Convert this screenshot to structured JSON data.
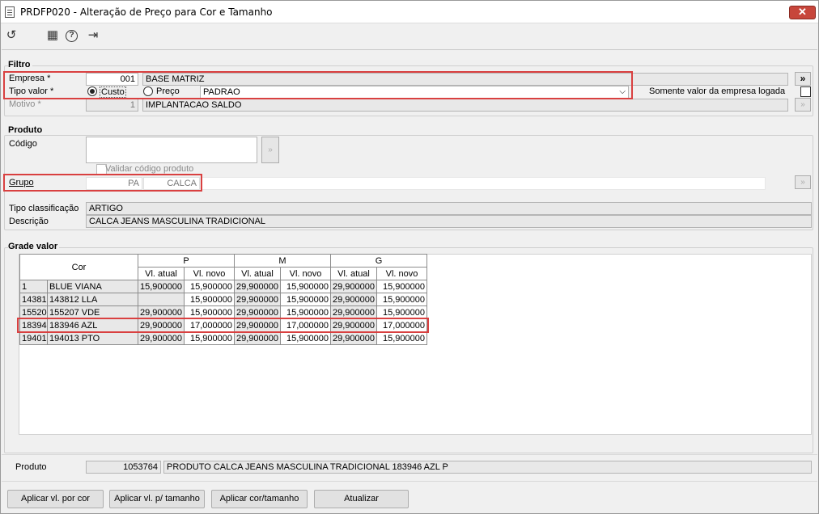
{
  "window": {
    "title": "PRDFP020 - Alteração de Preço para Cor e Tamanho",
    "close": "✕"
  },
  "toolbar": {
    "refresh": "↺",
    "calendar": "▦",
    "help": "?",
    "exit": "⇥"
  },
  "filtro": {
    "label": "Filtro",
    "empresa_label": "Empresa *",
    "empresa_code": "001",
    "empresa_name": "BASE MATRIZ",
    "tipo_valor_label": "Tipo valor *",
    "custo_label": "Custo",
    "preco_label": "Preço",
    "preco_select": "PADRAO",
    "motivo_label": "Motivo *",
    "motivo_code": "1",
    "motivo_name": "IMPLANTACAO SALDO",
    "somente_label": "Somente valor da empresa logada",
    "expand_btn": "»"
  },
  "produto": {
    "label": "Produto",
    "codigo_label": "Código",
    "validar_label": "Validar código produto",
    "grupo_label": "Grupo",
    "grupo_code": "PA",
    "grupo_name": "CALCA",
    "tipo_class_label": "Tipo classificação",
    "tipo_class_value": "ARTIGO",
    "descricao_label": "Descrição",
    "descricao_value": "CALCA JEANS MASCULINA TRADICIONAL"
  },
  "grade": {
    "label": "Grade valor",
    "cor_header": "Cor",
    "sizes": [
      "P",
      "M",
      "G"
    ],
    "sub_headers": [
      "Vl. atual",
      "Vl. novo"
    ],
    "rows": [
      {
        "code": "1",
        "name": "BLUE VIANA",
        "values": [
          "15,900000",
          "15,900000",
          "29,900000",
          "15,900000",
          "29,900000",
          "15,900000"
        ]
      },
      {
        "code": "14381",
        "name": "143812 LLA",
        "values": [
          "",
          "15,900000",
          "29,900000",
          "15,900000",
          "29,900000",
          "15,900000"
        ]
      },
      {
        "code": "15520",
        "name": "155207 VDE",
        "values": [
          "29,900000",
          "15,900000",
          "29,900000",
          "15,900000",
          "29,900000",
          "15,900000"
        ]
      },
      {
        "code": "18394",
        "name": "183946 AZL",
        "values": [
          "29,900000",
          "17,000000",
          "29,900000",
          "17,000000",
          "29,900000",
          "17,000000"
        ]
      },
      {
        "code": "19401",
        "name": "194013 PTO",
        "values": [
          "29,900000",
          "15,900000",
          "29,900000",
          "15,900000",
          "29,900000",
          "15,900000"
        ]
      }
    ]
  },
  "footer": {
    "produto_label": "Produto",
    "produto_code": "1053764",
    "produto_desc": "PRODUTO CALCA JEANS MASCULINA TRADICIONAL 183946 AZL P",
    "btn_aplicar_cor": "Aplicar vl. por cor",
    "btn_aplicar_tamanho": "Aplicar vl. p/ tamanho",
    "btn_aplicar_cor_tamanho": "Aplicar cor/tamanho",
    "btn_atualizar": "Atualizar"
  }
}
